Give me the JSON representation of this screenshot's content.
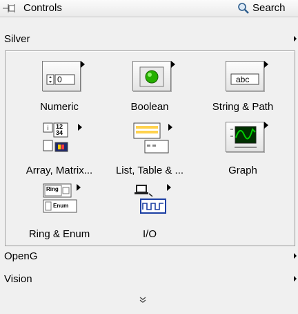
{
  "header": {
    "title": "Controls",
    "search_label": "Search"
  },
  "categories": [
    {
      "label": "Silver",
      "expanded": true
    },
    {
      "label": "OpenG",
      "expanded": false
    },
    {
      "label": "Vision",
      "expanded": false
    }
  ],
  "items": [
    {
      "label": "Numeric",
      "icon": "numeric-control-icon",
      "value": "0"
    },
    {
      "label": "Boolean",
      "icon": "boolean-led-icon"
    },
    {
      "label": "String & Path",
      "icon": "string-control-icon",
      "value": "abc"
    },
    {
      "label": "Array, Matrix...",
      "icon": "array-matrix-icon",
      "text_12": "12",
      "text_34": "34"
    },
    {
      "label": "List, Table & ...",
      "icon": "list-table-icon"
    },
    {
      "label": "Graph",
      "icon": "waveform-graph-icon"
    },
    {
      "label": "Ring & Enum",
      "icon": "ring-enum-icon",
      "ring_text": "Ring",
      "enum_text": "Enum"
    },
    {
      "label": "I/O",
      "icon": "io-icon"
    }
  ],
  "colors": {
    "accent_green": "#25b000",
    "graph_green": "#00d000"
  },
  "footer": {
    "more_glyph": "»"
  }
}
